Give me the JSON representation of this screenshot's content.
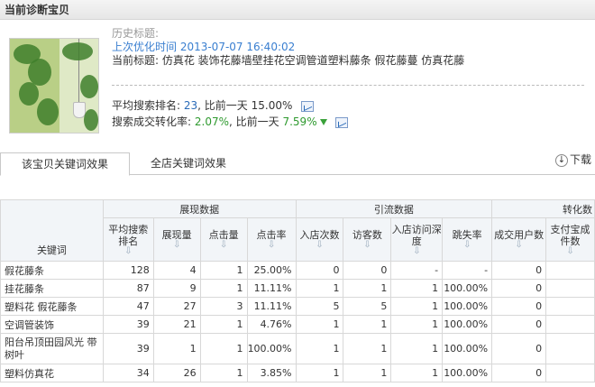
{
  "page_title": "当前诊断宝贝",
  "product": {
    "history_label": "历史标题:",
    "last_optimized": "上次优化时间 2013-07-07 16:40:02",
    "current_title": "当前标题: 仿真花 装饰花藤墙壁挂花空调管道塑料藤条 假花藤蔓 仿真花藤"
  },
  "metrics": {
    "rank_label": "平均搜索排名:",
    "rank_value": "23",
    "rank_compare": ", 比前一天",
    "rank_change": "15.00%",
    "conv_label": "搜索成交转化率:",
    "conv_value": "2.07%",
    "conv_compare": ", 比前一天",
    "conv_change": "7.59%"
  },
  "tabs": {
    "active": "该宝贝关键词效果",
    "inactive": "全店关键词效果",
    "download": "下载"
  },
  "table": {
    "groups": {
      "show": "展现数据",
      "traffic": "引流数据",
      "conv": "转化数"
    },
    "headers": {
      "keyword": "关键词",
      "avg_rank": "平均搜索排名",
      "impressions": "展现量",
      "clicks": "点击量",
      "ctr": "点击率",
      "visits": "入店次数",
      "visitors": "访客数",
      "depth": "入店访问深度",
      "bounce": "跳失率",
      "buyers": "成交用户数",
      "paid": "支付宝成件数"
    },
    "rows": [
      {
        "keyword": "假花藤条",
        "avg_rank": "128",
        "impressions": "4",
        "clicks": "1",
        "ctr": "25.00%",
        "visits": "0",
        "visitors": "0",
        "depth": "-",
        "bounce": "-",
        "buyers": "0"
      },
      {
        "keyword": "挂花藤条",
        "avg_rank": "87",
        "impressions": "9",
        "clicks": "1",
        "ctr": "11.11%",
        "visits": "1",
        "visitors": "1",
        "depth": "1",
        "bounce": "100.00%",
        "buyers": "0"
      },
      {
        "keyword": "塑料花 假花藤条",
        "avg_rank": "47",
        "impressions": "27",
        "clicks": "3",
        "ctr": "11.11%",
        "visits": "5",
        "visitors": "5",
        "depth": "1",
        "bounce": "100.00%",
        "buyers": "0"
      },
      {
        "keyword": "空调管装饰",
        "avg_rank": "39",
        "impressions": "21",
        "clicks": "1",
        "ctr": "4.76%",
        "visits": "1",
        "visitors": "1",
        "depth": "1",
        "bounce": "100.00%",
        "buyers": "0"
      },
      {
        "keyword": "阳台吊顶田园风光 带树叶",
        "avg_rank": "39",
        "impressions": "1",
        "clicks": "1",
        "ctr": "100.00%",
        "visits": "1",
        "visitors": "1",
        "depth": "1",
        "bounce": "100.00%",
        "buyers": "0"
      },
      {
        "keyword": "塑料仿真花",
        "avg_rank": "34",
        "impressions": "26",
        "clicks": "1",
        "ctr": "3.85%",
        "visits": "1",
        "visitors": "1",
        "depth": "1",
        "bounce": "100.00%",
        "buyers": "0"
      }
    ]
  }
}
